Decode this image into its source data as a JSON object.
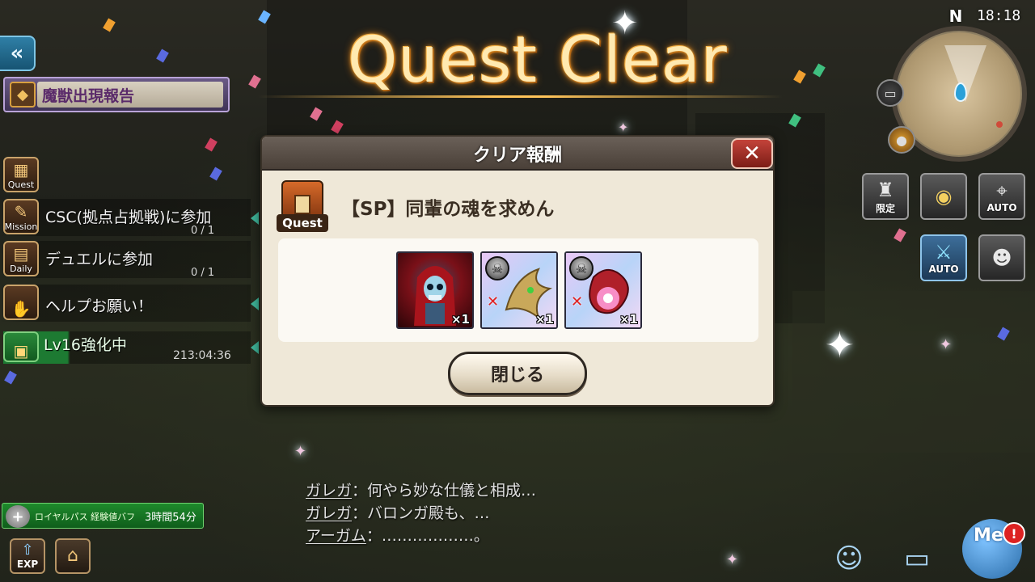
{
  "title": "Quest Clear",
  "left_panel": {
    "report_banner": "魔獣出現報告",
    "icons": {
      "quest": "Quest",
      "mission": "Mission",
      "daily": "Daily"
    },
    "missions": [
      {
        "text": "CSC(拠点占拠戦)に参加",
        "count": "0 / 1"
      },
      {
        "text": "デュエルに参加",
        "count": "0 / 1"
      },
      {
        "text": "ヘルプお願い！",
        "count": ""
      }
    ],
    "level_row": {
      "text": "Lv16強化中",
      "timer": "213:04:36"
    }
  },
  "buff": {
    "label": "ロイヤルパス 経験値バフ",
    "time": "3時間54分"
  },
  "bottom_left": {
    "exp_label": "EXP"
  },
  "hud": {
    "compass": "N",
    "clock": "18:18"
  },
  "right_buttons": {
    "limited": "限定",
    "auto1": "AUTO",
    "auto2": "AUTO"
  },
  "me_button": {
    "label": "Me",
    "badge": "!"
  },
  "modal": {
    "title": "クリア報酬",
    "close_x": "✕",
    "quest_icon_label": "Quest",
    "quest_name": "【SP】同輩の魂を求めん",
    "rewards": [
      {
        "name": "skeleton-reaper-card",
        "qty": "×1"
      },
      {
        "name": "bone-dragon-material",
        "qty": "×1"
      },
      {
        "name": "crimson-orb-material",
        "qty": "×1"
      }
    ],
    "close_button": "閉じる"
  },
  "dialogue": [
    {
      "speaker": "ガレガ",
      "sep": "：",
      "text": "何やら妙な仕儀と相成…"
    },
    {
      "speaker": "ガレガ",
      "sep": "：",
      "text": "バロンガ殿も、…"
    },
    {
      "speaker": "アーガム",
      "sep": "：",
      "text": "………………。"
    }
  ],
  "colors": {
    "title_gold": "#ffe9b0",
    "close_red": "#c3433a",
    "level_green": "#1d7a32",
    "modal_bg": "#efe8d8"
  }
}
